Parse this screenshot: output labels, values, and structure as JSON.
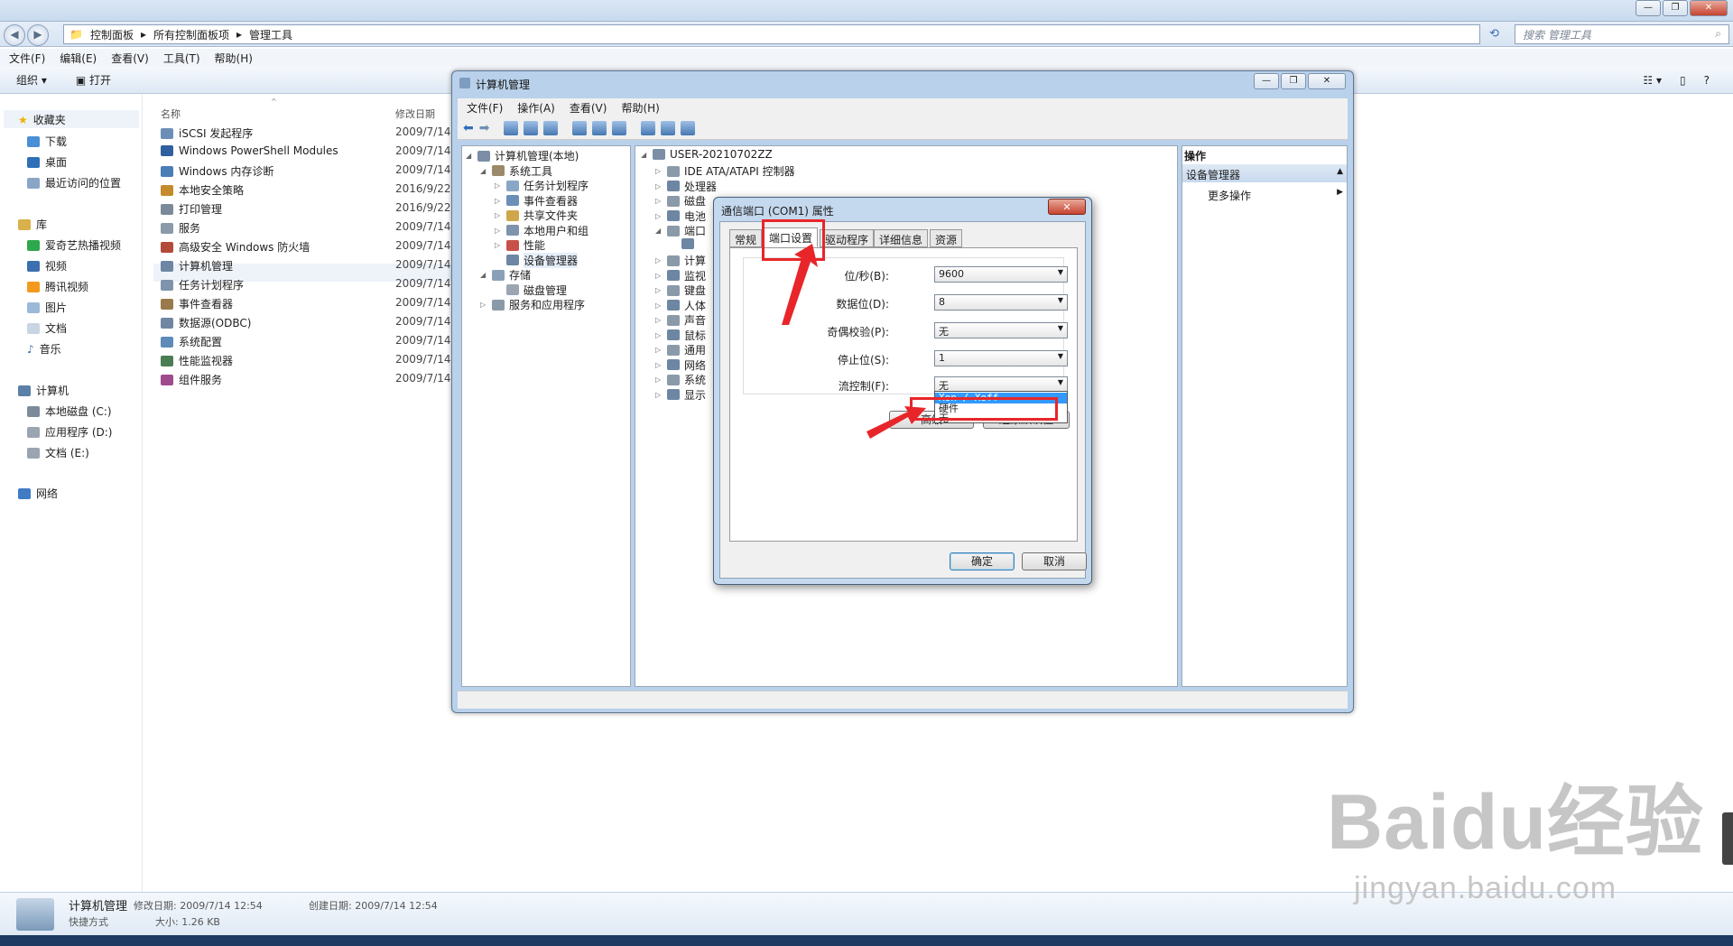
{
  "explorer": {
    "address": [
      "控制面板",
      "所有控制面板项",
      "管理工具"
    ],
    "search_placeholder": "搜索 管理工具",
    "menu": [
      "文件(F)",
      "编辑(E)",
      "查看(V)",
      "工具(T)",
      "帮助(H)"
    ],
    "commands": [
      "组织 ▾",
      "打开"
    ],
    "nav": {
      "favorites": "收藏夹",
      "favorites_items": [
        "下载",
        "桌面",
        "最近访问的位置"
      ],
      "libraries": "库",
      "libraries_items": [
        "爱奇艺热播视频",
        "视频",
        "腾讯视频",
        "图片",
        "文档",
        "音乐"
      ],
      "computer": "计算机",
      "computer_items": [
        "本地磁盘 (C:)",
        "应用程序 (D:)",
        "文档 (E:)"
      ],
      "network": "网络"
    },
    "columns": {
      "name": "名称",
      "date": "修改日期"
    },
    "files": [
      {
        "name": "iSCSI 发起程序",
        "date": "2009/7/14"
      },
      {
        "name": "Windows PowerShell Modules",
        "date": "2009/7/14"
      },
      {
        "name": "Windows 内存诊断",
        "date": "2009/7/14"
      },
      {
        "name": "本地安全策略",
        "date": "2016/9/22"
      },
      {
        "name": "打印管理",
        "date": "2016/9/22"
      },
      {
        "name": "服务",
        "date": "2009/7/14"
      },
      {
        "name": "高级安全 Windows 防火墙",
        "date": "2009/7/14"
      },
      {
        "name": "计算机管理",
        "date": "2009/7/14"
      },
      {
        "name": "任务计划程序",
        "date": "2009/7/14"
      },
      {
        "name": "事件查看器",
        "date": "2009/7/14"
      },
      {
        "name": "数据源(ODBC)",
        "date": "2009/7/14"
      },
      {
        "name": "系统配置",
        "date": "2009/7/14"
      },
      {
        "name": "性能监视器",
        "date": "2009/7/14"
      },
      {
        "name": "组件服务",
        "date": "2009/7/14"
      }
    ],
    "status": {
      "name": "计算机管理",
      "modified": "修改日期: 2009/7/14 12:54",
      "created": "创建日期: 2009/7/14 12:54",
      "type": "快捷方式",
      "size": "大小: 1.26 KB"
    }
  },
  "cm": {
    "title": "计算机管理",
    "menu": [
      "文件(F)",
      "操作(A)",
      "查看(V)",
      "帮助(H)"
    ],
    "tree": [
      {
        "label": "计算机管理(本地)",
        "level": 0,
        "expander": "◢"
      },
      {
        "label": "系统工具",
        "level": 1,
        "expander": "◢"
      },
      {
        "label": "任务计划程序",
        "level": 2,
        "expander": "▷"
      },
      {
        "label": "事件查看器",
        "level": 2,
        "expander": "▷"
      },
      {
        "label": "共享文件夹",
        "level": 2,
        "expander": "▷"
      },
      {
        "label": "本地用户和组",
        "level": 2,
        "expander": "▷"
      },
      {
        "label": "性能",
        "level": 2,
        "expander": "▷"
      },
      {
        "label": "设备管理器",
        "level": 2,
        "expander": ""
      },
      {
        "label": "存储",
        "level": 1,
        "expander": "◢"
      },
      {
        "label": "磁盘管理",
        "level": 2,
        "expander": ""
      },
      {
        "label": "服务和应用程序",
        "level": 1,
        "expander": "▷"
      }
    ],
    "devices_root": "USER-20210702ZZ",
    "devices": [
      "IDE ATA/ATAPI 控制器",
      "处理器",
      "磁盘",
      "电池",
      "端口",
      "",
      "计算",
      "监视",
      "键盘",
      "人体",
      "声音",
      "鼠标",
      "通用",
      "网络",
      "系统",
      "显示"
    ],
    "actions": {
      "header": "操作",
      "section": "设备管理器",
      "more": "更多操作"
    }
  },
  "dialog": {
    "title": "通信端口 (COM1) 属性",
    "tabs": [
      "常规",
      "端口设置",
      "驱动程序",
      "详细信息",
      "资源"
    ],
    "fields": [
      {
        "label": "位/秒(B):",
        "value": "9600"
      },
      {
        "label": "数据位(D):",
        "value": "8"
      },
      {
        "label": "奇偶校验(P):",
        "value": "无"
      },
      {
        "label": "停止位(S):",
        "value": "1"
      },
      {
        "label": "流控制(F):",
        "value": "无"
      }
    ],
    "flow_options": [
      "Xon / Xoff",
      "硬件",
      "无"
    ],
    "advanced_button": "高级",
    "restore_button": "还原默认值",
    "ok": "确定",
    "cancel": "取消"
  },
  "watermark": {
    "logo": "Baidu经验",
    "url": "jingyan.baidu.com"
  },
  "colors": {
    "annotation": "#e8262a",
    "selection": "#3399ff"
  }
}
